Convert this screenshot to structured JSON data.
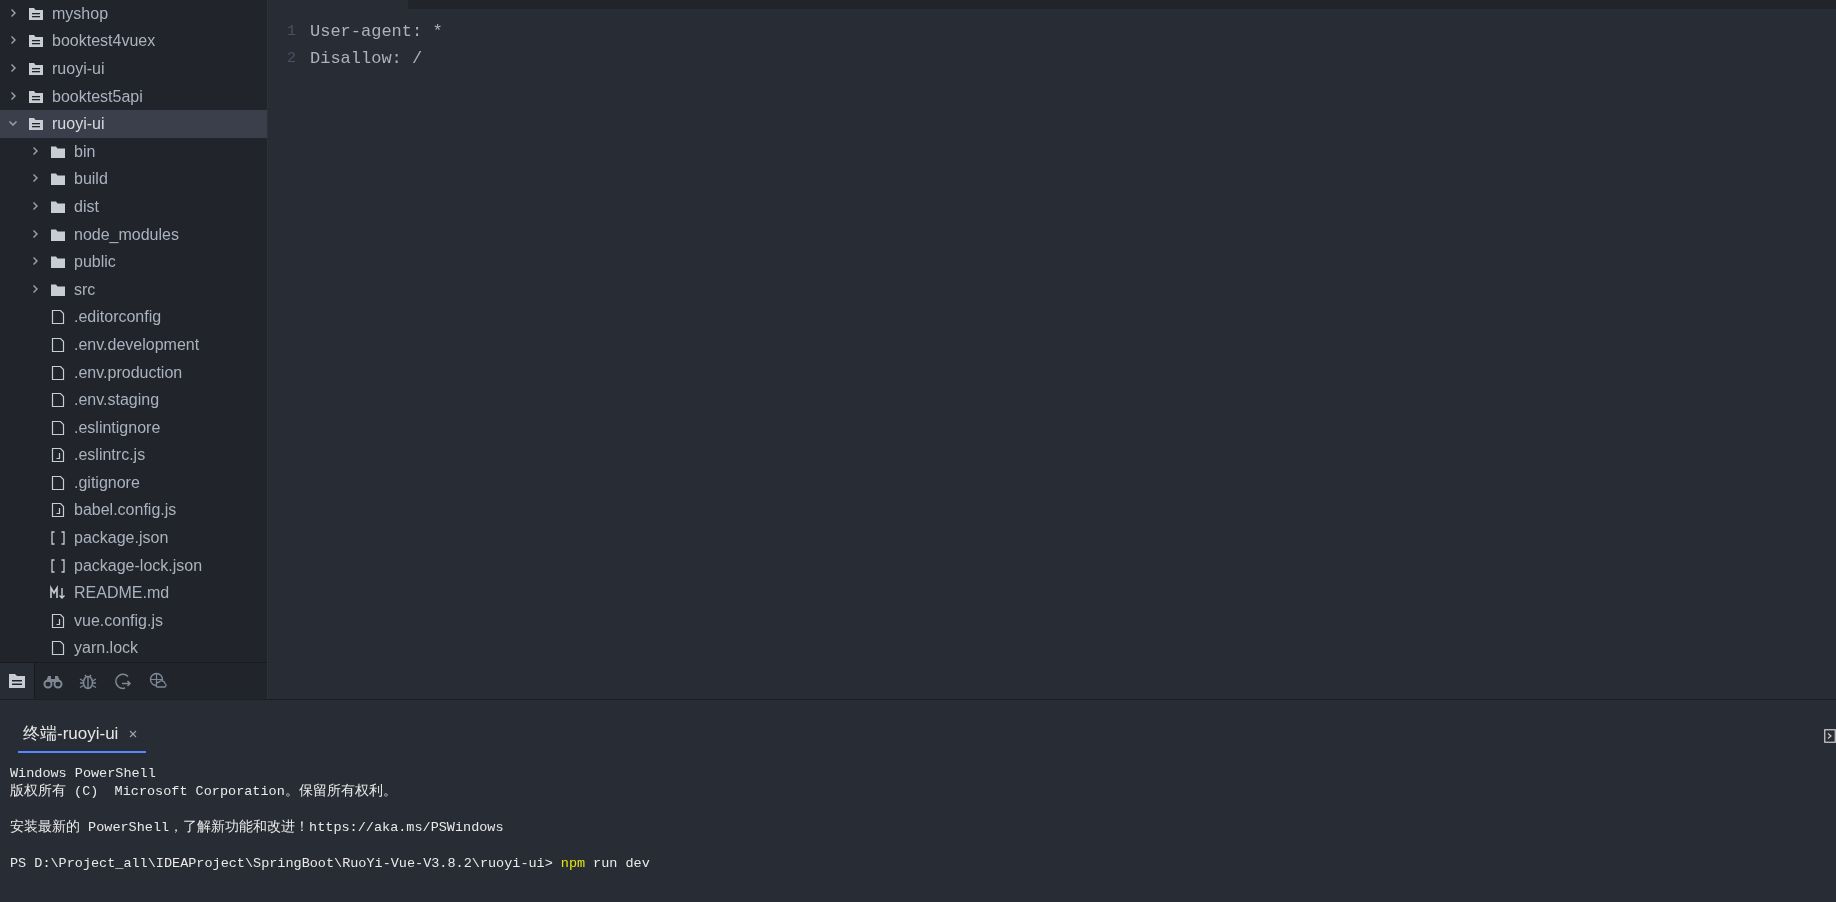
{
  "sidebar": {
    "projects": [
      {
        "name": "myshop",
        "expanded": false,
        "selected": false
      },
      {
        "name": "booktest4vuex",
        "expanded": false,
        "selected": false
      },
      {
        "name": "ruoyi-ui",
        "expanded": false,
        "selected": false
      },
      {
        "name": "booktest5api",
        "expanded": false,
        "selected": false
      },
      {
        "name": "ruoyi-ui",
        "expanded": true,
        "selected": true,
        "children": [
          {
            "name": "bin",
            "kind": "folder",
            "expanded": false
          },
          {
            "name": "build",
            "kind": "folder",
            "expanded": false
          },
          {
            "name": "dist",
            "kind": "folder",
            "expanded": false
          },
          {
            "name": "node_modules",
            "kind": "folder",
            "expanded": false
          },
          {
            "name": "public",
            "kind": "folder",
            "expanded": false
          },
          {
            "name": "src",
            "kind": "folder",
            "expanded": false
          },
          {
            "name": ".editorconfig",
            "kind": "file"
          },
          {
            "name": ".env.development",
            "kind": "file"
          },
          {
            "name": ".env.production",
            "kind": "file"
          },
          {
            "name": ".env.staging",
            "kind": "file"
          },
          {
            "name": ".eslintignore",
            "kind": "file"
          },
          {
            "name": ".eslintrc.js",
            "kind": "js"
          },
          {
            "name": ".gitignore",
            "kind": "file"
          },
          {
            "name": "babel.config.js",
            "kind": "js"
          },
          {
            "name": "package.json",
            "kind": "json"
          },
          {
            "name": "package-lock.json",
            "kind": "json"
          },
          {
            "name": "README.md",
            "kind": "md"
          },
          {
            "name": "vue.config.js",
            "kind": "js"
          },
          {
            "name": "yarn.lock",
            "kind": "file"
          }
        ]
      }
    ],
    "toolbar": [
      {
        "kind": "files",
        "selected": true
      },
      {
        "kind": "search",
        "selected": false
      },
      {
        "kind": "debug",
        "selected": false
      },
      {
        "kind": "git",
        "selected": false
      },
      {
        "kind": "web",
        "selected": false
      }
    ]
  },
  "editor": {
    "lines": [
      {
        "number": "1",
        "text": "User-agent: *"
      },
      {
        "number": "2",
        "text": "Disallow: /"
      }
    ]
  },
  "terminal": {
    "tab": {
      "label": "终端-ruoyi-ui",
      "selected": true
    },
    "blocks": [
      [
        [
          {
            "text": "Windows PowerShell",
            "kind": "output"
          }
        ],
        [
          {
            "text": "版权所有 (C)  Microsoft Corporation。保留所有权利。",
            "kind": "output"
          }
        ]
      ],
      [
        [
          {
            "text": "安装最新的 PowerShell，了解新功能和改进！https://aka.ms/PSWindows",
            "kind": "output"
          }
        ]
      ],
      [
        [
          {
            "text": "PS D:\\Project_all\\IDEAProject\\SpringBoot\\RuoYi-Vue-V3.8.2\\ruoyi-ui>",
            "kind": "prompt"
          },
          {
            "text": "npm",
            "kind": "command"
          },
          {
            "text": "run dev",
            "kind": "output"
          }
        ]
      ]
    ]
  }
}
